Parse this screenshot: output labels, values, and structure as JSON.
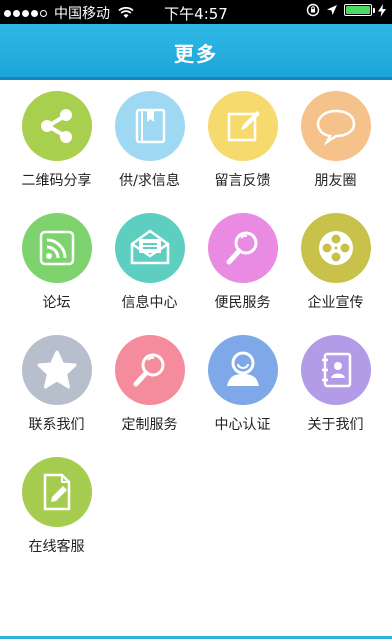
{
  "status_bar": {
    "carrier": "中国移动",
    "time": "下午4:57"
  },
  "header": {
    "title": "更多"
  },
  "menu": [
    {
      "label": "二维码分享",
      "icon": "share-icon",
      "color": "#a9cf4f"
    },
    {
      "label": "供/求信息",
      "icon": "book-icon",
      "color": "#9fd8f3"
    },
    {
      "label": "留言反馈",
      "icon": "edit-icon",
      "color": "#f6da6d"
    },
    {
      "label": "朋友圈",
      "icon": "chat-bubble-icon",
      "color": "#f6c28c"
    },
    {
      "label": "论坛",
      "icon": "rss-icon",
      "color": "#7ed36f"
    },
    {
      "label": "信息中心",
      "icon": "envelope-icon",
      "color": "#5ecec0"
    },
    {
      "label": "便民服务",
      "icon": "search-icon",
      "color": "#e98be3"
    },
    {
      "label": "企业宣传",
      "icon": "film-reel-icon",
      "color": "#c8c24a"
    },
    {
      "label": "联系我们",
      "icon": "star-icon",
      "color": "#b7bfcc"
    },
    {
      "label": "定制服务",
      "icon": "magnifier-icon",
      "color": "#f58c9e"
    },
    {
      "label": "中心认证",
      "icon": "user-icon",
      "color": "#7ea8e8"
    },
    {
      "label": "关于我们",
      "icon": "contacts-icon",
      "color": "#b49be8"
    },
    {
      "label": "在线客服",
      "icon": "document-edit-icon",
      "color": "#a6cc4f"
    }
  ]
}
